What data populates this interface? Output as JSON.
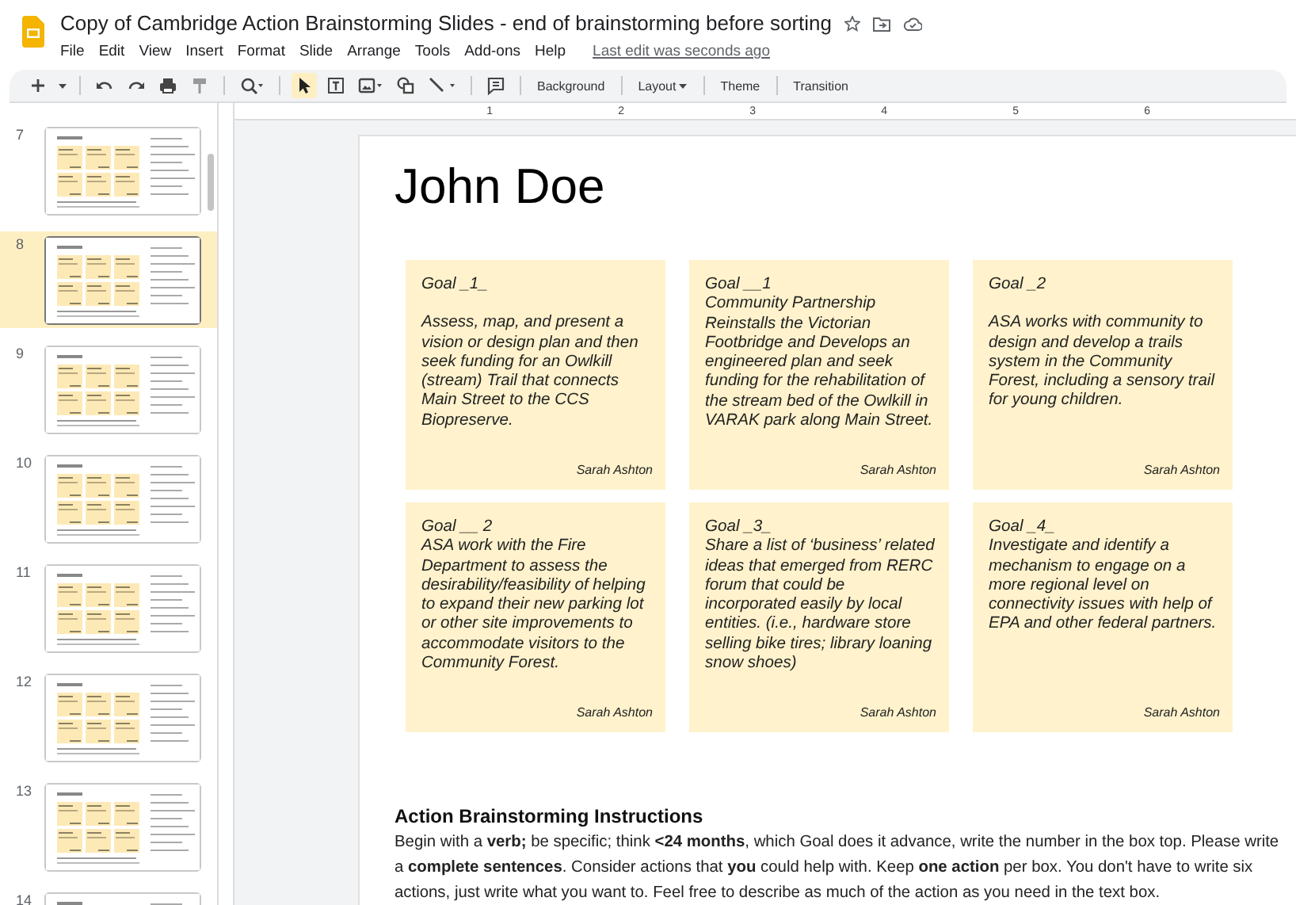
{
  "document": {
    "title": "Copy of Cambridge Action Brainstorming Slides - end of brainstorming before sorting",
    "menu": [
      "File",
      "Edit",
      "View",
      "Insert",
      "Format",
      "Slide",
      "Arrange",
      "Tools",
      "Add-ons",
      "Help"
    ],
    "last_edit": "Last edit was seconds ago"
  },
  "toolbar": {
    "tools": [
      {
        "selected": false
      },
      {
        "selected": false
      },
      {
        "selected": false
      },
      {
        "selected": false
      },
      {
        "selected": false
      },
      {
        "selected": false
      },
      {
        "selected": true
      },
      {
        "selected": false
      },
      {
        "selected": false
      },
      {
        "selected": false
      },
      {
        "selected": false
      },
      {
        "selected": false
      }
    ],
    "commands": [
      {
        "label": "Background",
        "menu": false
      },
      {
        "label": "Layout",
        "menu": true
      },
      {
        "label": "Theme",
        "menu": false
      },
      {
        "label": "Transition",
        "menu": false
      }
    ]
  },
  "ruler": {
    "numbers": [
      "1",
      "2",
      "3",
      "4",
      "5",
      "6"
    ]
  },
  "filmstrip": {
    "slides": [
      {
        "number": "7",
        "selected": false
      },
      {
        "number": "8",
        "selected": true
      },
      {
        "number": "9",
        "selected": false
      },
      {
        "number": "10",
        "selected": false
      },
      {
        "number": "11",
        "selected": false
      },
      {
        "number": "12",
        "selected": false
      },
      {
        "number": "13",
        "selected": false
      },
      {
        "number": "14",
        "selected": false
      }
    ]
  },
  "slide": {
    "title": "John Doe",
    "cards": [
      {
        "heading": "Goal _1_",
        "spaced": true,
        "body": "Assess, map, and present a vision  or design plan and then seek funding for an Owlkill (stream) Trail that connects Main Street to the CCS Biopreserve.",
        "author": "Sarah Ashton"
      },
      {
        "heading": "Goal __1",
        "spaced": false,
        "body": "Community Partnership Reinstalls the Victorian Footbridge and Develops an engineered plan and seek funding for the rehabilitation of the stream bed of the Owlkill in VARAK park along Main Street.",
        "author": "Sarah Ashton"
      },
      {
        "heading": "Goal _2",
        "spaced": true,
        "body": "ASA works with community to design and develop a trails system in the Community Forest, including a sensory trail for young children.",
        "author": "Sarah Ashton"
      },
      {
        "heading": "Goal __ 2",
        "spaced": false,
        "body": "ASA work with the Fire Department to assess the desirability/feasibility of helping to expand their new parking lot or other site improvements to accommodate visitors to the Community Forest.",
        "author": "Sarah Ashton"
      },
      {
        "heading": "Goal _3_",
        "spaced": false,
        "body": "Share a list of ‘business’ related ideas that emerged from RERC forum that could be incorporated easily by local entities.  (i.e., hardware store selling bike tires; library loaning snow shoes)",
        "author": "Sarah Ashton"
      },
      {
        "heading": "Goal _4_",
        "spaced": false,
        "body": "Investigate and identify a mechanism to engage on a more regional level on connectivity issues with help of EPA and other federal partners.",
        "author": "Sarah Ashton"
      }
    ],
    "instructions": {
      "heading": "Action Brainstorming Instructions",
      "text": "Begin with a **verb;** be specific; think **<24 months**, which Goal does it advance, write the number in the box top. Please write a **complete sentences**. Consider actions that **you** could help with. Keep **one action** per box. You don't have to write six actions, just write what you want to. Feel free to describe as much of the action as you need in the text box."
    }
  }
}
